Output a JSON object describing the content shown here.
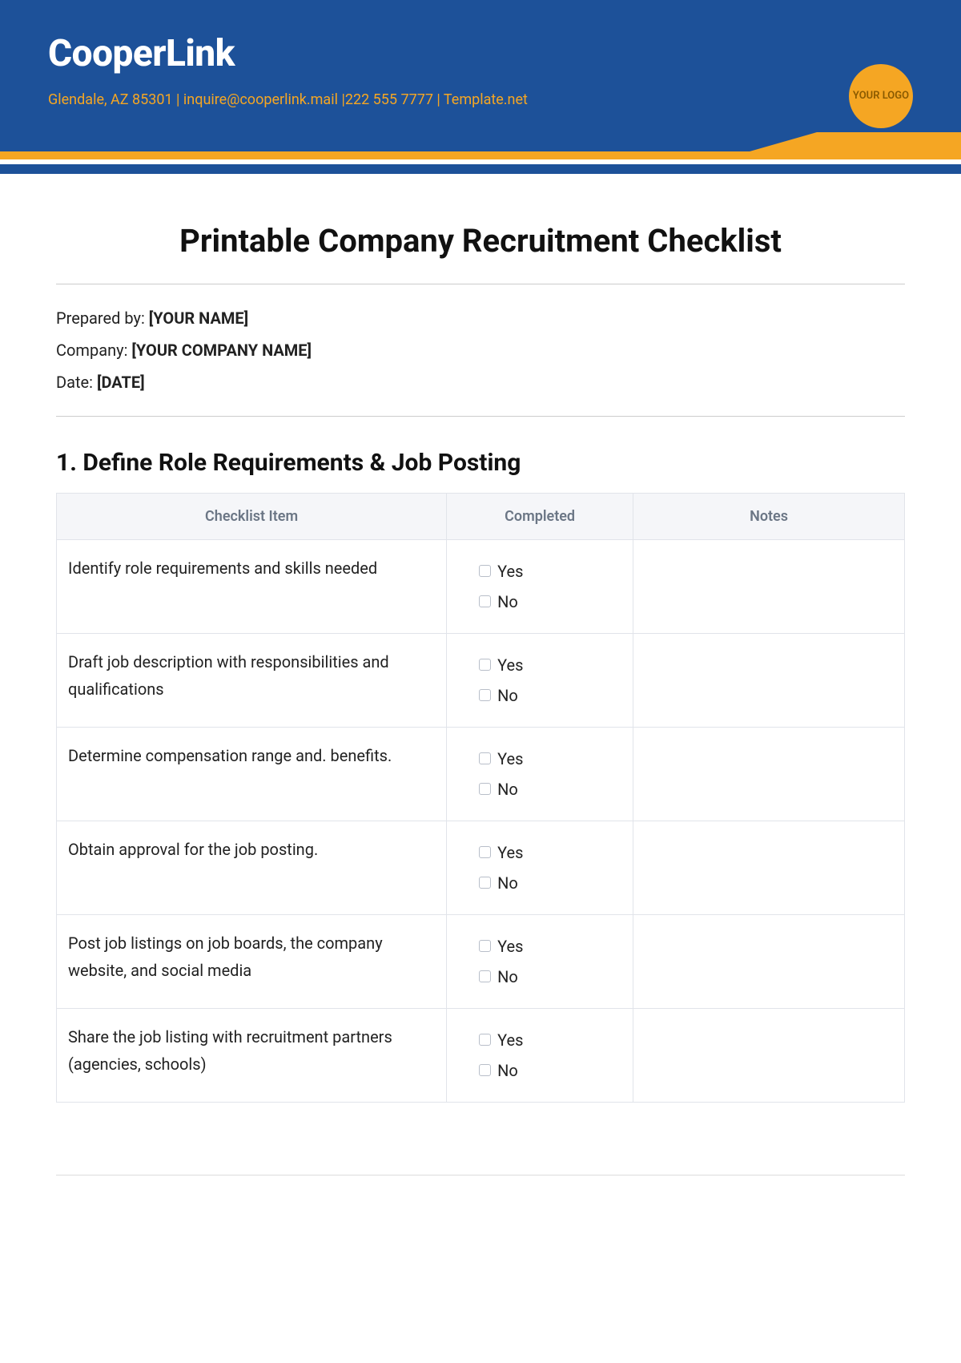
{
  "header": {
    "brand": "CooperLink",
    "contact": "Glendale, AZ 85301 | inquire@cooperlink.mail |222 555 7777 | Template.net",
    "logo_placeholder": "YOUR LOGO"
  },
  "document": {
    "title": "Printable Company Recruitment Checklist",
    "meta": {
      "prepared_label": "Prepared by: ",
      "prepared_value": "[YOUR NAME]",
      "company_label": "Company: ",
      "company_value": "[YOUR COMPANY NAME]",
      "date_label": "Date: ",
      "date_value": "[DATE]"
    }
  },
  "section": {
    "heading": "1. Define Role Requirements & Job Posting",
    "columns": {
      "item": "Checklist Item",
      "completed": "Completed",
      "notes": "Notes"
    },
    "yes_label": "Yes",
    "no_label": "No",
    "rows": [
      {
        "item": "Identify role requirements and skills needed",
        "notes": ""
      },
      {
        "item": "Draft job description with responsibilities and qualifications",
        "notes": ""
      },
      {
        "item": "Determine compensation range and. benefits.",
        "notes": ""
      },
      {
        "item": "Obtain approval for the job posting.",
        "notes": ""
      },
      {
        "item": "Post job listings on job boards, the company website, and social media",
        "notes": ""
      },
      {
        "item": "Share the job listing with recruitment partners (agencies, schools)",
        "notes": ""
      }
    ]
  }
}
